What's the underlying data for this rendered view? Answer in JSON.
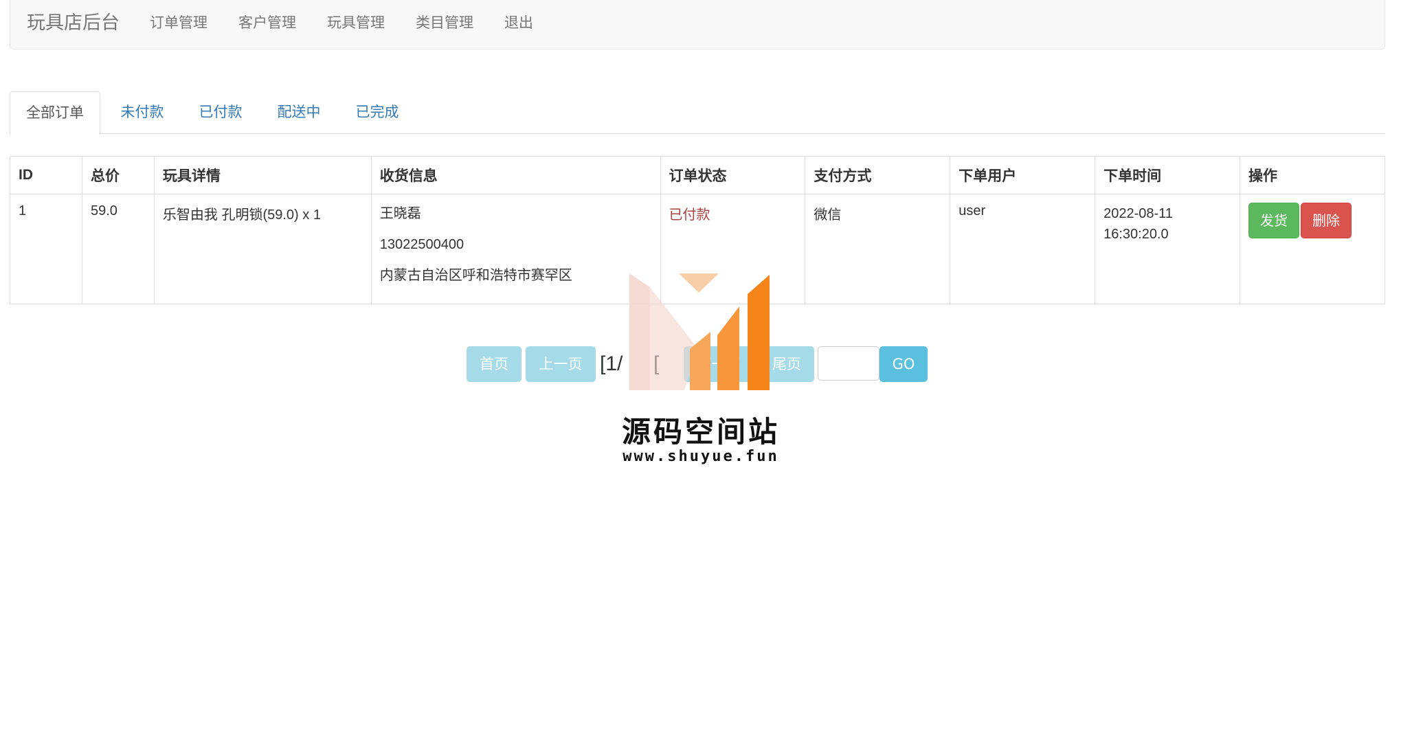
{
  "navbar": {
    "brand": "玩具店后台",
    "items": [
      {
        "label": "订单管理"
      },
      {
        "label": "客户管理"
      },
      {
        "label": "玩具管理"
      },
      {
        "label": "类目管理"
      },
      {
        "label": "退出"
      }
    ]
  },
  "tabs": [
    {
      "label": "全部订单",
      "active": true
    },
    {
      "label": "未付款"
    },
    {
      "label": "已付款"
    },
    {
      "label": "配送中"
    },
    {
      "label": "已完成"
    }
  ],
  "table": {
    "headers": [
      "ID",
      "总价",
      "玩具详情",
      "收货信息",
      "订单状态",
      "支付方式",
      "下单用户",
      "下单时间",
      "操作"
    ],
    "rows": [
      {
        "id": "1",
        "total": "59.0",
        "detail": "乐智由我 孔明锁(59.0) x 1",
        "receiver_name": "王晓磊",
        "receiver_phone": "13022500400",
        "receiver_address": "内蒙古自治区呼和浩特市赛罕区",
        "status": "已付款",
        "payment": "微信",
        "user": "user",
        "date": "2022-08-11",
        "time": "16:30:20.0",
        "actions": {
          "ship": "发货",
          "delete": "删除"
        }
      }
    ]
  },
  "pager": {
    "first": "首页",
    "prev": "上一页",
    "info_left": "[1/",
    "info_right": "[",
    "next": "下一页",
    "last": "尾页",
    "go": "GO",
    "input_value": ""
  },
  "watermark": {
    "title": "源码空间站",
    "url": "www.shuyue.fun"
  },
  "colors": {
    "primary_link": "#337ab7",
    "success": "#5cb85c",
    "danger": "#d9534f",
    "info": "#5bc0de",
    "status_paid": "#a94442"
  }
}
